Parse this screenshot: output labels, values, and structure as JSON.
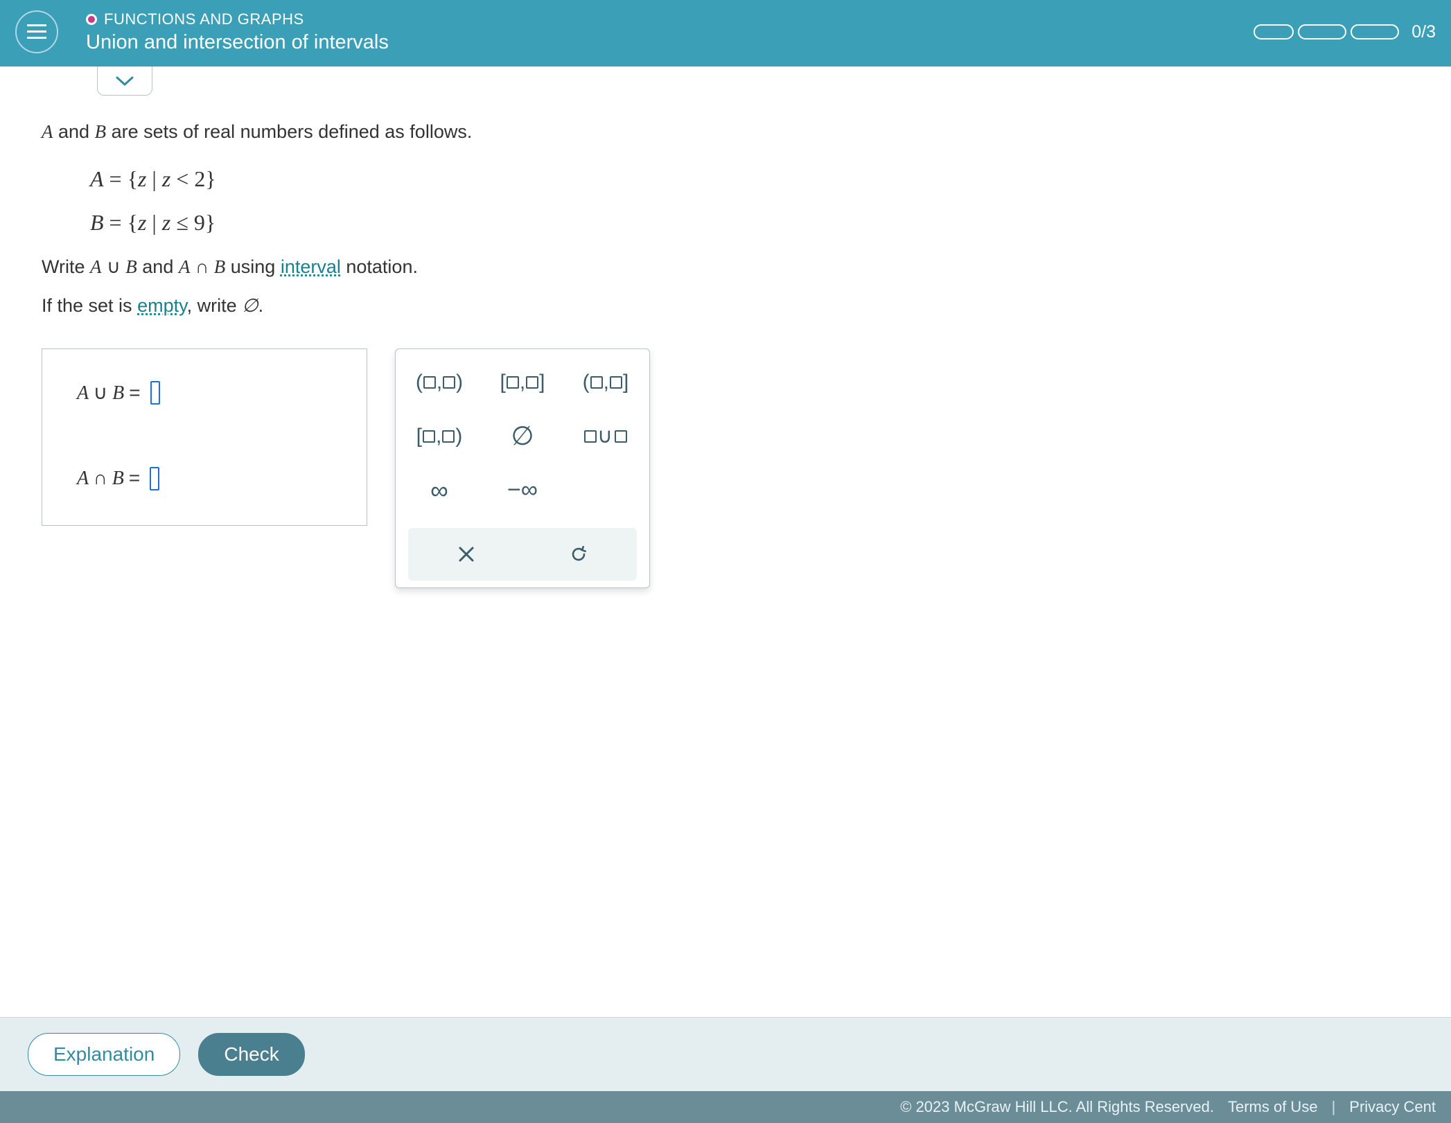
{
  "header": {
    "breadcrumb": "FUNCTIONS AND GRAPHS",
    "title": "Union and intersection of intervals",
    "progress_label": "0/3"
  },
  "problem": {
    "intro_prefix": " and ",
    "intro_suffix": " are sets of real numbers defined as follows.",
    "set_A_label": "A",
    "set_B_label": "B",
    "set_A_def": "A = { z | z < 2 }",
    "set_B_def": "B = { z | z ≤ 9 }",
    "instr_write": "Write ",
    "instr_and": " and ",
    "instr_using": " using ",
    "link_interval": "interval",
    "instr_notation": " notation.",
    "instr_empty_pre": "If the set is ",
    "link_empty": "empty",
    "instr_empty_post": ", write ",
    "empty_symbol": "∅",
    "period": "."
  },
  "answers": {
    "union_label": "A ∪ B =",
    "intersect_label": "A ∩ B ="
  },
  "keypad": {
    "open_open": "(□,□)",
    "closed_closed": "[□,□]",
    "open_closed": "(□,□]",
    "closed_open": "[□,□)",
    "empty_set": "∅",
    "union": "□∪□",
    "infinity": "∞",
    "neg_infinity": "−∞",
    "clear": "×",
    "reset": "↺"
  },
  "actions": {
    "explanation": "Explanation",
    "check": "Check"
  },
  "footer": {
    "copyright": "© 2023 McGraw Hill LLC. All Rights Reserved.",
    "terms": "Terms of Use",
    "privacy": "Privacy Cent"
  }
}
